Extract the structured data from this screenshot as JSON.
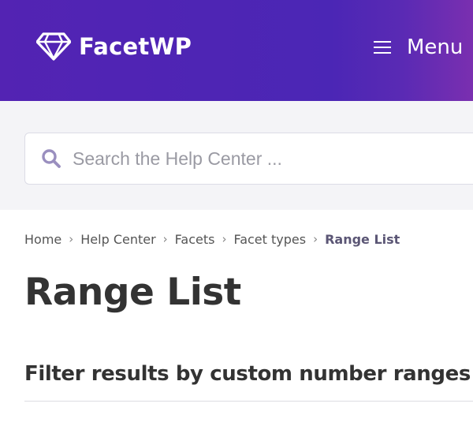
{
  "header": {
    "logo_text": "FacetWP",
    "logo_icon": "diamond-icon",
    "menu_label": "Menu",
    "menu_icon": "hamburger-icon",
    "colors": {
      "gradient_start": "#5323b3",
      "gradient_end": "#7a2fb0"
    }
  },
  "search": {
    "placeholder": "Search the Help Center ...",
    "value": "",
    "icon": "search-icon",
    "icon_color": "#9a8fbf"
  },
  "breadcrumb": {
    "items": [
      "Home",
      "Help Center",
      "Facets",
      "Facet types"
    ],
    "current": "Range List",
    "separator": "›"
  },
  "page": {
    "title": "Range List",
    "subtitle": "Filter results by custom number ranges"
  }
}
